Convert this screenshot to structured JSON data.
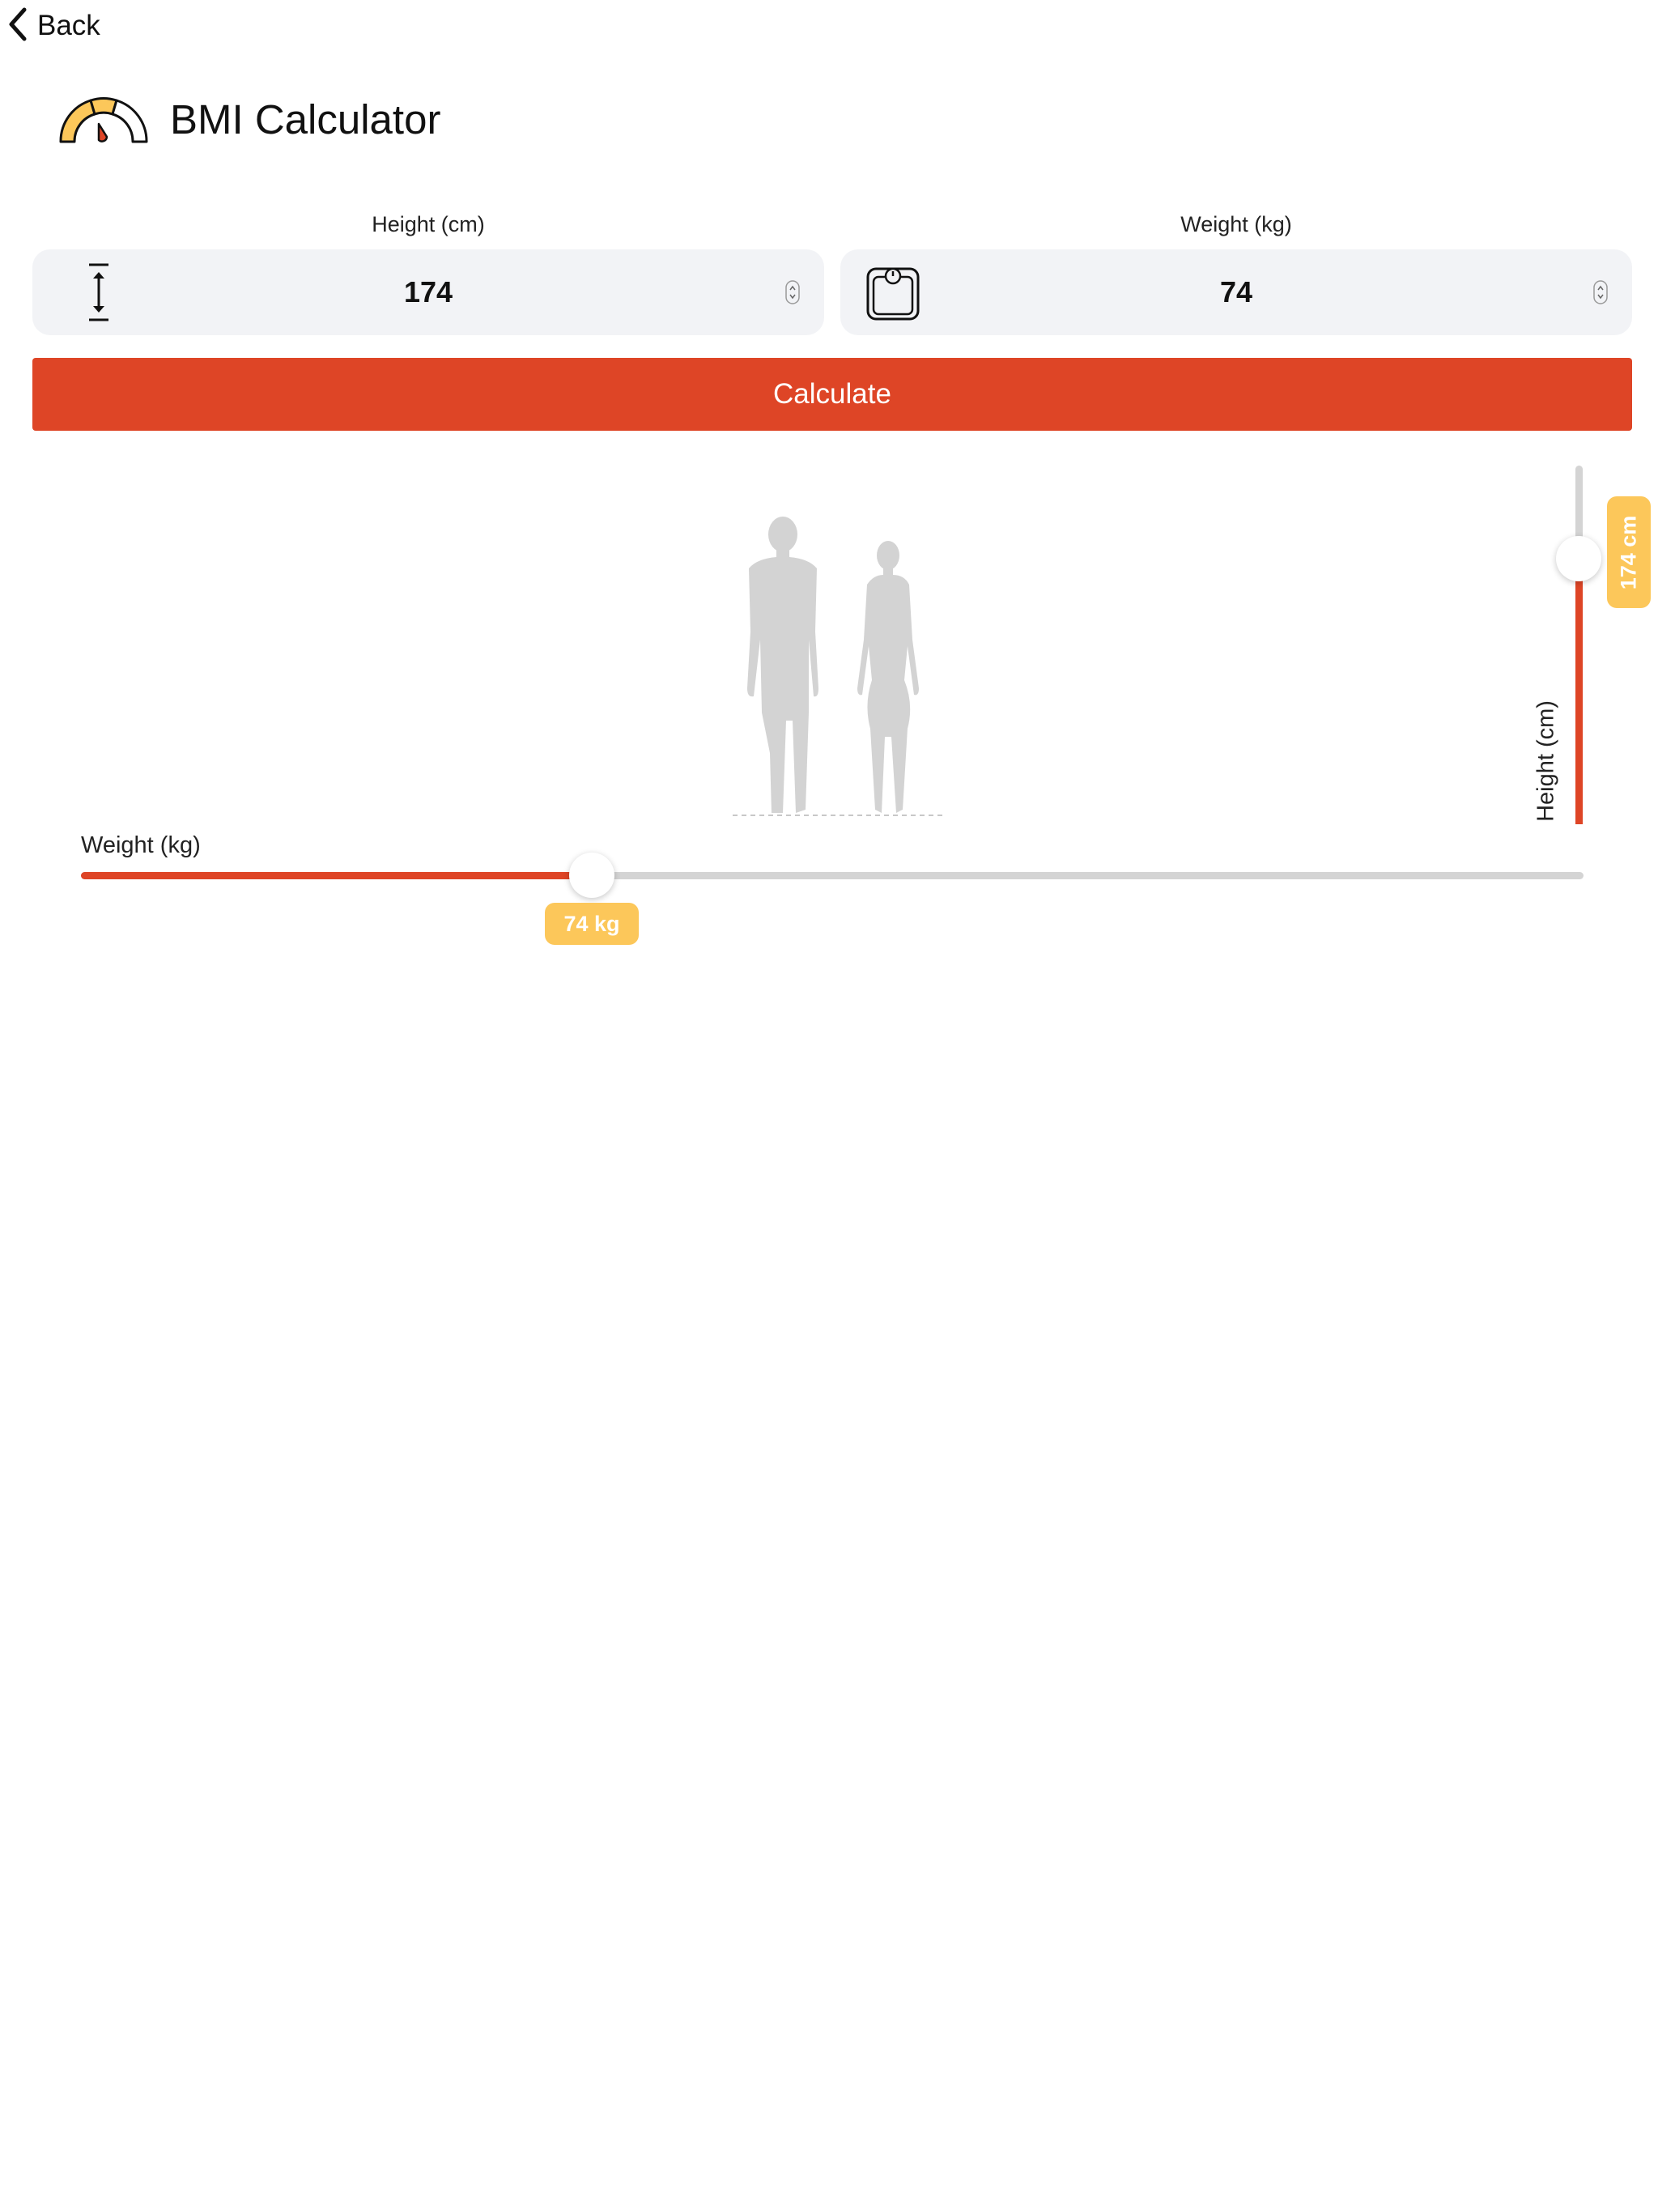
{
  "nav": {
    "back_label": "Back",
    "back_icon": "chevron-left-icon"
  },
  "header": {
    "title": "BMI Calculator",
    "icon": "gauge-icon"
  },
  "form": {
    "height": {
      "label": "Height (cm)",
      "value": "174",
      "icon": "height-arrow-icon"
    },
    "weight": {
      "label": "Weight (kg)",
      "value": "74",
      "icon": "scale-icon"
    },
    "calculate_label": "Calculate"
  },
  "sliders": {
    "height": {
      "label": "Height (cm)",
      "badge": "174 cm",
      "value": 174,
      "fraction": 0.74
    },
    "weight": {
      "label": "Weight (kg)",
      "badge": "74 kg",
      "value": 74,
      "fraction": 0.34
    }
  },
  "colors": {
    "accent": "#de4526",
    "badge": "#fcc75a",
    "track": "#d4d4d4",
    "input_bg": "#f2f3f6",
    "figure": "#d3d3d3"
  }
}
